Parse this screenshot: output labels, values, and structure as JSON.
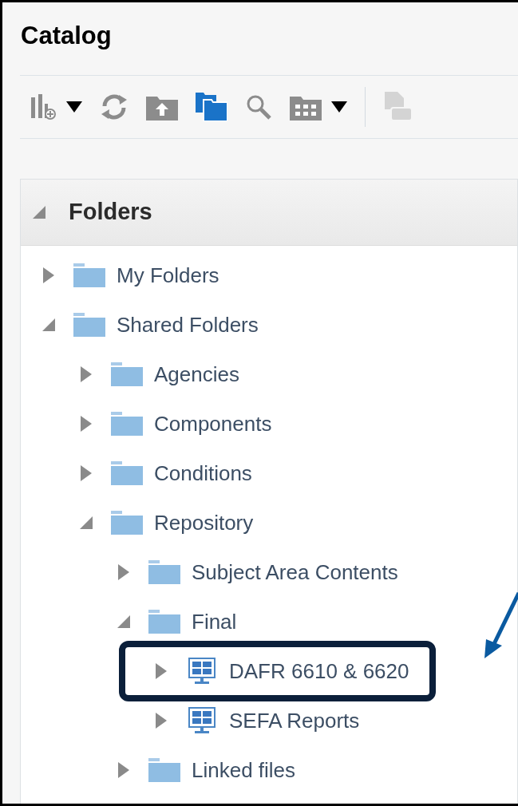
{
  "title": "Catalog",
  "toolbar": [
    {
      "kind": "new"
    },
    {
      "kind": "dropdown"
    },
    {
      "kind": "refresh"
    },
    {
      "kind": "upload"
    },
    {
      "kind": "folders"
    },
    {
      "kind": "search"
    },
    {
      "kind": "view"
    },
    {
      "kind": "dropdown"
    },
    {
      "kind": "separator"
    },
    {
      "kind": "doc"
    }
  ],
  "panel": {
    "title": "Folders",
    "expanded": true
  },
  "tree": [
    {
      "label": "My Folders",
      "kind": "folder",
      "expanded": false,
      "highlighted": false
    },
    {
      "label": "Shared Folders",
      "kind": "folder",
      "expanded": true,
      "highlighted": false,
      "children": [
        {
          "label": "Agencies",
          "kind": "folder",
          "expanded": false,
          "highlighted": false
        },
        {
          "label": "Components",
          "kind": "folder",
          "expanded": false,
          "highlighted": false
        },
        {
          "label": "Conditions",
          "kind": "folder",
          "expanded": false,
          "highlighted": false
        },
        {
          "label": "Repository",
          "kind": "folder",
          "expanded": true,
          "highlighted": false,
          "children": [
            {
              "label": "Subject Area Contents",
              "kind": "folder",
              "expanded": false,
              "highlighted": false
            },
            {
              "label": "Final",
              "kind": "folder",
              "expanded": true,
              "highlighted": false,
              "children": [
                {
                  "label": "DAFR 6610 & 6620",
                  "kind": "dashboard",
                  "expanded": false,
                  "highlighted": true
                },
                {
                  "label": "SEFA Reports",
                  "kind": "dashboard",
                  "expanded": false,
                  "highlighted": false
                }
              ]
            },
            {
              "label": "Linked files",
              "kind": "folder",
              "expanded": false,
              "highlighted": false
            }
          ]
        }
      ]
    }
  ]
}
